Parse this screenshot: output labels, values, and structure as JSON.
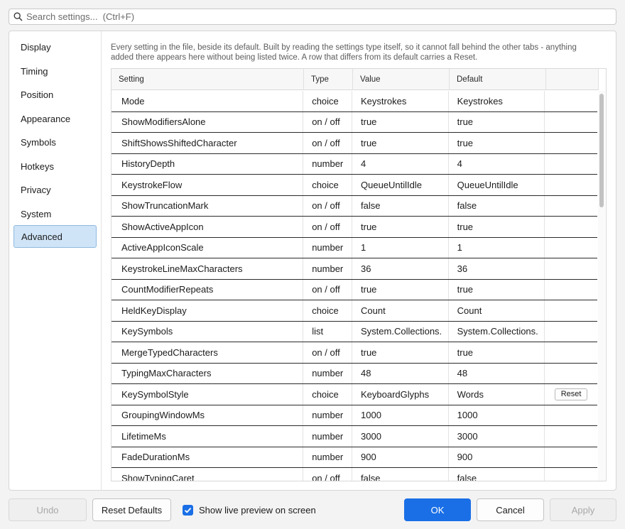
{
  "search": {
    "placeholder": "Search settings...  (Ctrl+F)",
    "icon": "search-icon"
  },
  "sidebar": {
    "items": [
      {
        "label": "Display",
        "active": false
      },
      {
        "label": "Timing",
        "active": false
      },
      {
        "label": "Position",
        "active": false
      },
      {
        "label": "Appearance",
        "active": false
      },
      {
        "label": "Symbols",
        "active": false
      },
      {
        "label": "Hotkeys",
        "active": false
      },
      {
        "label": "Privacy",
        "active": false
      },
      {
        "label": "System",
        "active": false
      },
      {
        "label": "Advanced",
        "active": true
      }
    ]
  },
  "main": {
    "description": "Every setting in the file, beside its default. Built by reading the settings type itself, so it cannot fall behind the other tabs - anything added there appears here without being listed twice. A row that differs from its default carries a Reset.",
    "columns": [
      "Setting",
      "Type",
      "Value",
      "Default",
      ""
    ],
    "rows": [
      {
        "setting": "Mode",
        "type": "choice",
        "value": "Keystrokes",
        "default": "Keystrokes",
        "reset": ""
      },
      {
        "setting": "ShowModifiersAlone",
        "type": "on / off",
        "value": "true",
        "default": "true",
        "reset": ""
      },
      {
        "setting": "ShiftShowsShiftedCharacter",
        "type": "on / off",
        "value": "true",
        "default": "true",
        "reset": ""
      },
      {
        "setting": "HistoryDepth",
        "type": "number",
        "value": "4",
        "default": "4",
        "reset": ""
      },
      {
        "setting": "KeystrokeFlow",
        "type": "choice",
        "value": "QueueUntilIdle",
        "default": "QueueUntilIdle",
        "reset": ""
      },
      {
        "setting": "ShowTruncationMark",
        "type": "on / off",
        "value": "false",
        "default": "false",
        "reset": ""
      },
      {
        "setting": "ShowActiveAppIcon",
        "type": "on / off",
        "value": "true",
        "default": "true",
        "reset": ""
      },
      {
        "setting": "ActiveAppIconScale",
        "type": "number",
        "value": "1",
        "default": "1",
        "reset": ""
      },
      {
        "setting": "KeystrokeLineMaxCharacters",
        "type": "number",
        "value": "36",
        "default": "36",
        "reset": ""
      },
      {
        "setting": "CountModifierRepeats",
        "type": "on / off",
        "value": "true",
        "default": "true",
        "reset": ""
      },
      {
        "setting": "HeldKeyDisplay",
        "type": "choice",
        "value": "Count",
        "default": "Count",
        "reset": ""
      },
      {
        "setting": "KeySymbols",
        "type": "list",
        "value": "System.Collections.",
        "default": "System.Collections.",
        "reset": ""
      },
      {
        "setting": "MergeTypedCharacters",
        "type": "on / off",
        "value": "true",
        "default": "true",
        "reset": ""
      },
      {
        "setting": "TypingMaxCharacters",
        "type": "number",
        "value": "48",
        "default": "48",
        "reset": ""
      },
      {
        "setting": "KeySymbolStyle",
        "type": "choice",
        "value": "KeyboardGlyphs",
        "default": "Words",
        "reset": "Reset"
      },
      {
        "setting": "GroupingWindowMs",
        "type": "number",
        "value": "1000",
        "default": "1000",
        "reset": ""
      },
      {
        "setting": "LifetimeMs",
        "type": "number",
        "value": "3000",
        "default": "3000",
        "reset": ""
      },
      {
        "setting": "FadeDurationMs",
        "type": "number",
        "value": "900",
        "default": "900",
        "reset": ""
      },
      {
        "setting": "ShowTypingCaret",
        "type": "on / off",
        "value": "false",
        "default": "false",
        "reset": ""
      }
    ]
  },
  "footer": {
    "undo": "Undo",
    "reset_defaults": "Reset Defaults",
    "live_preview_label": "Show live preview on screen",
    "live_preview_checked": true,
    "ok": "OK",
    "cancel": "Cancel",
    "apply": "Apply"
  },
  "colors": {
    "accent": "#1a6fe6",
    "active_nav_bg": "#cfe4f7"
  }
}
